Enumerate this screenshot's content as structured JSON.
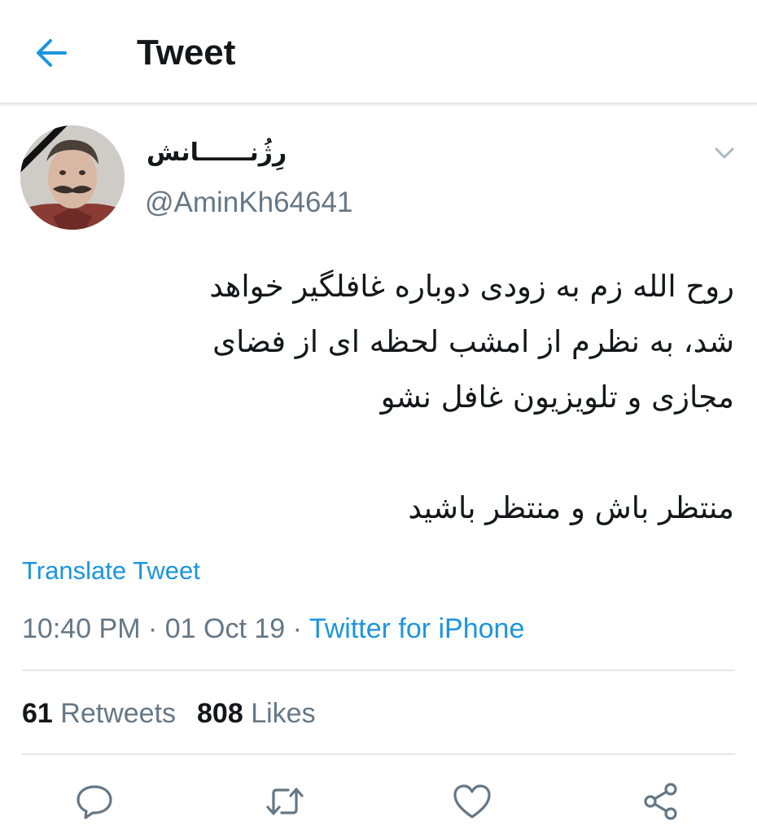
{
  "header": {
    "title": "Tweet",
    "back_icon": "arrow-left-icon",
    "accent_color": "#1b95e0"
  },
  "tweet": {
    "author": {
      "display_name": "رِژُنــــــانش",
      "handle": "@AminKh64641",
      "avatar": "avatar-image"
    },
    "menu_icon": "chevron-down-icon",
    "text_lines": [
      "روح الله زم به زودی دوباره غافلگیر خواهد",
      "شد، به نظرم از امشب لحظه ای از فضای",
      "مجازی و تلویزیون غافل نشو"
    ],
    "text_line_2": "منتظر باش و منتظر باشید",
    "translate_label": "Translate Tweet",
    "time": "10:40 PM",
    "date": "01 Oct 19",
    "separator": "·",
    "source": "Twitter for iPhone"
  },
  "stats": {
    "retweets_count": "61",
    "retweets_label": "Retweets",
    "likes_count": "808",
    "likes_label": "Likes"
  },
  "actions": [
    {
      "icon": "reply-icon"
    },
    {
      "icon": "retweet-icon"
    },
    {
      "icon": "like-heart-icon"
    },
    {
      "icon": "share-icon"
    }
  ],
  "colors": {
    "text_primary": "#14171a",
    "text_secondary": "#657786",
    "link": "#1b95e0",
    "divider": "#e1e8ed"
  }
}
